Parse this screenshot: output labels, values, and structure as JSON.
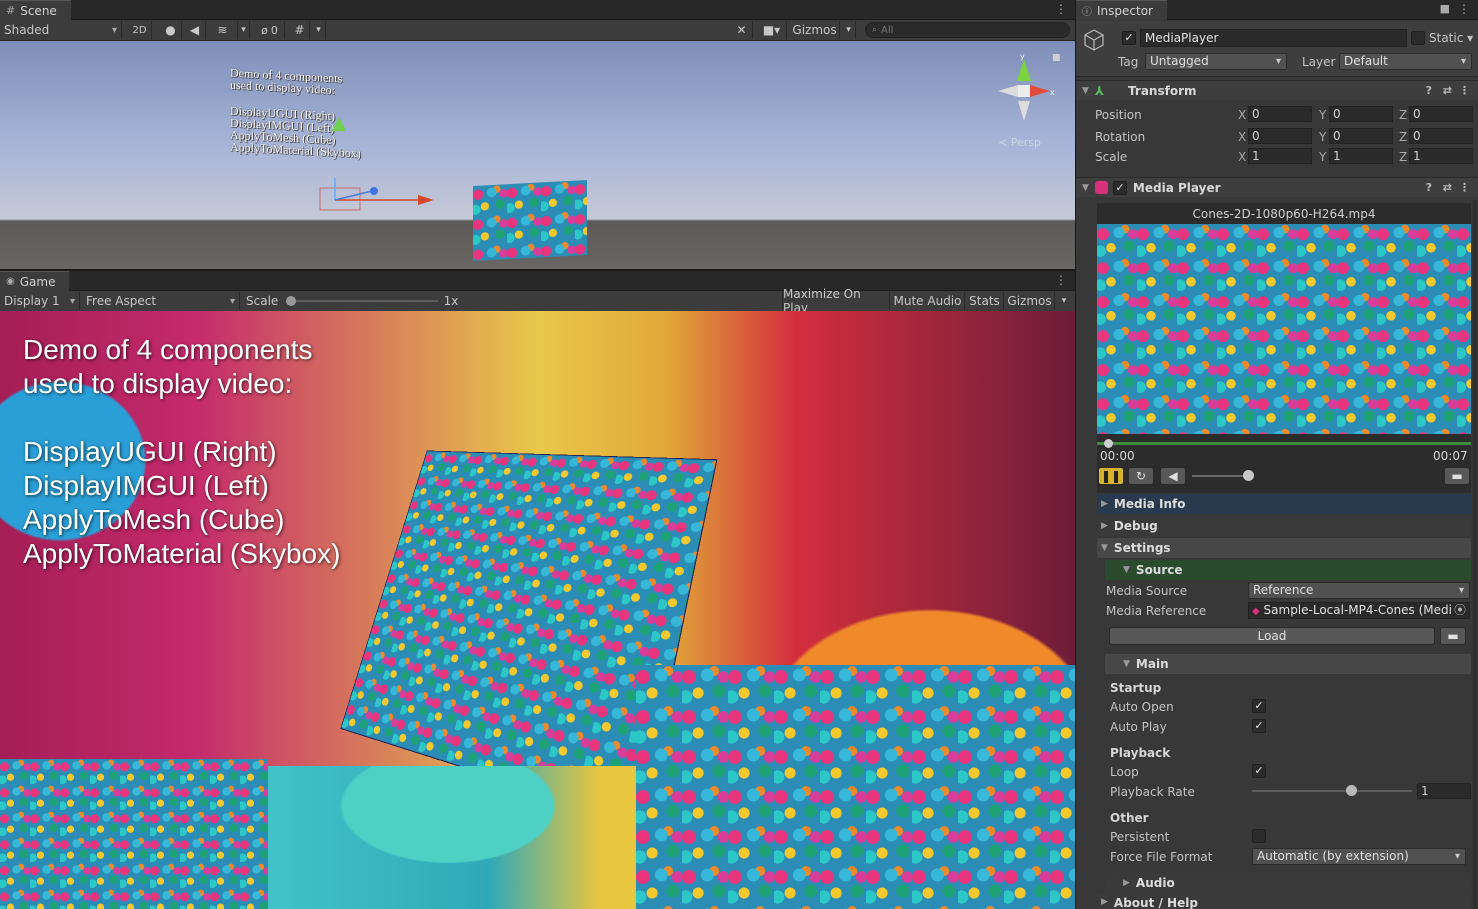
{
  "scene": {
    "tab": "Scene",
    "shading_mode": "Shaded",
    "btn_2d": "2D",
    "hidden_count": "0",
    "gizmos": "Gizmos",
    "search_placeholder": "All",
    "persp_label": "≺ Persp",
    "world_text": [
      "Demo of 4 components",
      "used to display video:",
      "DisplayUGUI (Right)",
      "DisplayIMGUI (Left)",
      "ApplyToMesh (Cube)",
      "ApplyToMaterial (Skybox)"
    ]
  },
  "game": {
    "tab": "Game",
    "display": "Display 1",
    "aspect": "Free Aspect",
    "scale_label": "Scale",
    "scale_value": "1x",
    "maximize_on_play": "Maximize On Play",
    "mute_audio": "Mute Audio",
    "stats": "Stats",
    "gizmos": "Gizmos",
    "overlay_lines": [
      "Demo of 4 components",
      "used to display video:",
      "",
      "DisplayUGUI (Right)",
      "DisplayIMGUI (Left)",
      "ApplyToMesh (Cube)",
      "ApplyToMaterial (Skybox)"
    ]
  },
  "inspector": {
    "tab": "Inspector",
    "object_name": "MediaPlayer",
    "static_label": "Static",
    "tag_label": "Tag",
    "tag_value": "Untagged",
    "layer_label": "Layer",
    "layer_value": "Default",
    "transform": {
      "title": "Transform",
      "position_label": "Position",
      "rotation_label": "Rotation",
      "scale_label": "Scale",
      "position": {
        "x": "0",
        "y": "0",
        "z": "0"
      },
      "rotation": {
        "x": "0",
        "y": "0",
        "z": "0"
      },
      "scale": {
        "x": "1",
        "y": "1",
        "z": "1"
      }
    },
    "media_player": {
      "title": "Media Player",
      "file_name": "Cones-2D-1080p60-H264.mp4",
      "time_current": "00:00",
      "time_total": "00:07",
      "media_info": "Media Info",
      "debug": "Debug",
      "settings": "Settings",
      "source": "Source",
      "media_source_label": "Media Source",
      "media_source_value": "Reference",
      "media_reference_label": "Media Reference",
      "media_reference_value": "Sample-Local-MP4-Cones (Medi",
      "load_button": "Load",
      "main": "Main",
      "startup": "Startup",
      "auto_open": "Auto Open",
      "auto_play": "Auto Play",
      "playback": "Playback",
      "loop": "Loop",
      "playback_rate_label": "Playback Rate",
      "playback_rate_value": "1",
      "other": "Other",
      "persistent": "Persistent",
      "force_file_format_label": "Force File Format",
      "force_file_format_value": "Automatic (by extension)",
      "audio": "Audio",
      "about_help": "About / Help"
    }
  },
  "colors": {
    "accent_yellow": "#d7b32b",
    "source_header": "#2b4b2e",
    "media_info_header": "#2a3a4e"
  }
}
